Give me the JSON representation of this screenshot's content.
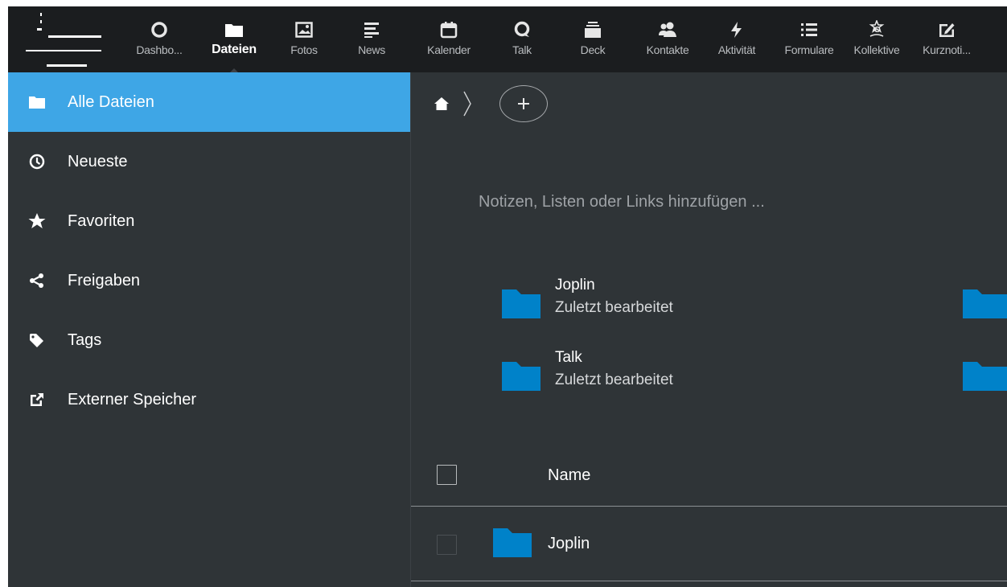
{
  "header": {
    "apps": [
      {
        "label": "Dashbo...",
        "icon": "circle-icon"
      },
      {
        "label": "Dateien",
        "icon": "folder-icon",
        "active": true
      },
      {
        "label": "Fotos",
        "icon": "image-icon"
      },
      {
        "label": "News",
        "icon": "lines-icon"
      },
      {
        "label": "Kalender",
        "icon": "calendar-icon"
      },
      {
        "label": "Talk",
        "icon": "talk-icon"
      },
      {
        "label": "Deck",
        "icon": "stack-icon"
      },
      {
        "label": "Kontakte",
        "icon": "contacts-icon"
      },
      {
        "label": "Aktivität",
        "icon": "bolt-icon"
      },
      {
        "label": "Formulare",
        "icon": "list-icon"
      },
      {
        "label": "Kollektive",
        "icon": "collective-icon"
      },
      {
        "label": "Kurznoti...",
        "icon": "edit-icon"
      }
    ]
  },
  "sidebar": {
    "items": [
      {
        "label": "Alle Dateien",
        "icon": "folder-icon",
        "active": true
      },
      {
        "label": "Neueste",
        "icon": "clock-icon"
      },
      {
        "label": "Favoriten",
        "icon": "star-icon"
      },
      {
        "label": "Freigaben",
        "icon": "share-icon"
      },
      {
        "label": "Tags",
        "icon": "tag-icon"
      },
      {
        "label": "Externer Speicher",
        "icon": "external-link-icon"
      }
    ]
  },
  "main": {
    "notes_placeholder": "Notizen, Listen oder Links hinzufügen ...",
    "recent": [
      {
        "title": "Joplin",
        "subtitle": "Zuletzt bearbeitet"
      },
      {
        "title": "Talk",
        "subtitle": "Zuletzt bearbeitet"
      }
    ],
    "list": {
      "name_header": "Name",
      "rows": [
        {
          "name": "Joplin"
        }
      ]
    }
  },
  "colors": {
    "accent": "#3ea6e6",
    "folder": "#0082c9",
    "header_bg": "#1b1d1f",
    "background": "#2f3437"
  }
}
